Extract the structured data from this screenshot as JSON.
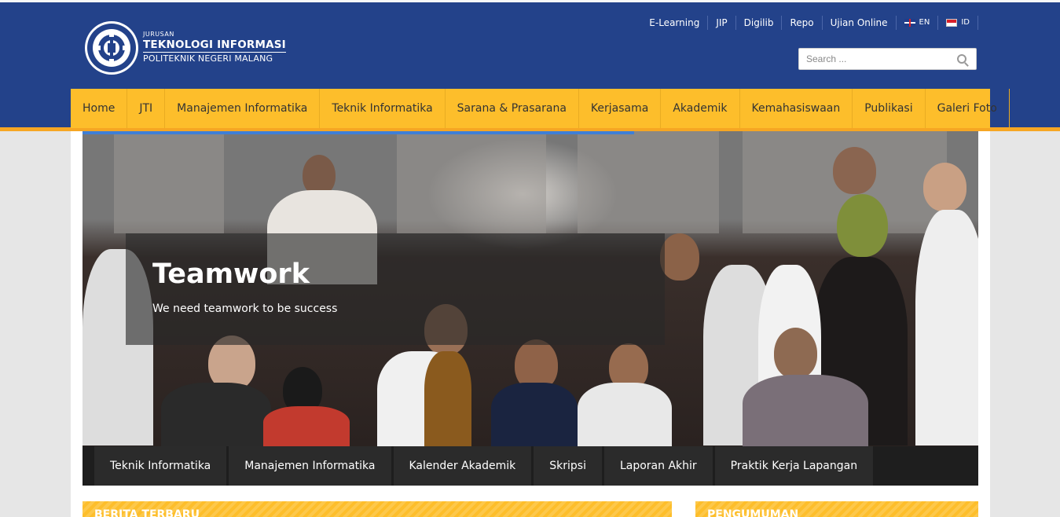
{
  "header": {
    "logo": {
      "small": "JURUSAN",
      "main": "TEKNOLOGI INFORMASI",
      "sub": "POLITEKNIK NEGERI MALANG"
    },
    "top_links": [
      {
        "label": "E-Learning"
      },
      {
        "label": "JIP"
      },
      {
        "label": "Digilib"
      },
      {
        "label": "Repo"
      },
      {
        "label": "Ujian Online"
      }
    ],
    "languages": [
      {
        "code": "EN",
        "flag": "uk-flag"
      },
      {
        "code": "ID",
        "flag": "indonesia-flag"
      }
    ],
    "search_placeholder": "Search ..."
  },
  "nav": {
    "items": [
      "Home",
      "JTI",
      "Manajemen Informatika",
      "Teknik Informatika",
      "Sarana & Prasarana",
      "Kerjasama",
      "Akademik",
      "Kemahasiswaan",
      "Publikasi",
      "Galeri Foto"
    ]
  },
  "slider": {
    "title": "Teamwork",
    "subtitle": "We need teamwork to be success",
    "progress": 0.616
  },
  "quick_links": [
    "Teknik Informatika",
    "Manajemen Informatika",
    "Kalender Akademik",
    "Skripsi",
    "Laporan Akhir",
    "Praktik Kerja Lapangan"
  ],
  "sections": {
    "news": "BERITA TERBARU",
    "announcements": "PENGUMUMAN"
  },
  "colors": {
    "header_bg": "#23428a",
    "nav_bg": "#fdbe2b",
    "accent_orange": "#f6a623",
    "progress_blue": "#3f7fd6",
    "quickbar_bg": "#1e1e1e"
  }
}
